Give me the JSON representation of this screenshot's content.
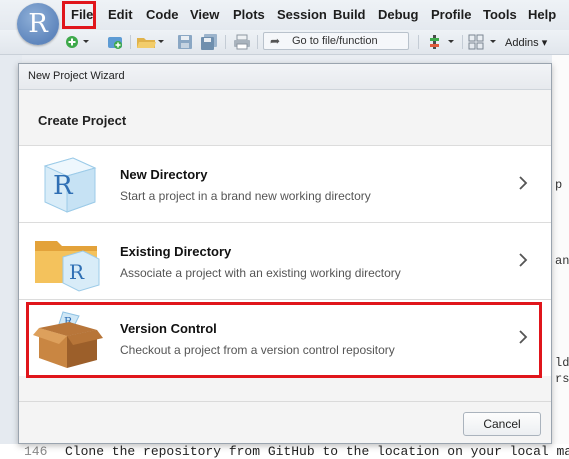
{
  "menubar": {
    "logo": "R",
    "items": [
      "File",
      "Edit",
      "Code",
      "View",
      "Plots",
      "Session",
      "Build",
      "Debug",
      "Profile",
      "Tools",
      "Help"
    ]
  },
  "toolbar": {
    "goto_label": "Go to file/function",
    "addins_label": "Addins"
  },
  "background": {
    "line_number": "146",
    "code_line": "Clone the repository from GitHub to the location on your local mac",
    "fragments": [
      "p",
      "an",
      "ld",
      "rs"
    ]
  },
  "dialog": {
    "title": "New Project Wizard",
    "heading": "Create Project",
    "options": [
      {
        "title": "New Directory",
        "description": "Start a project in a brand new working directory"
      },
      {
        "title": "Existing Directory",
        "description": "Associate a project with an existing working directory"
      },
      {
        "title": "Version Control",
        "description": "Checkout a project from a version control repository"
      }
    ],
    "cancel_label": "Cancel"
  }
}
